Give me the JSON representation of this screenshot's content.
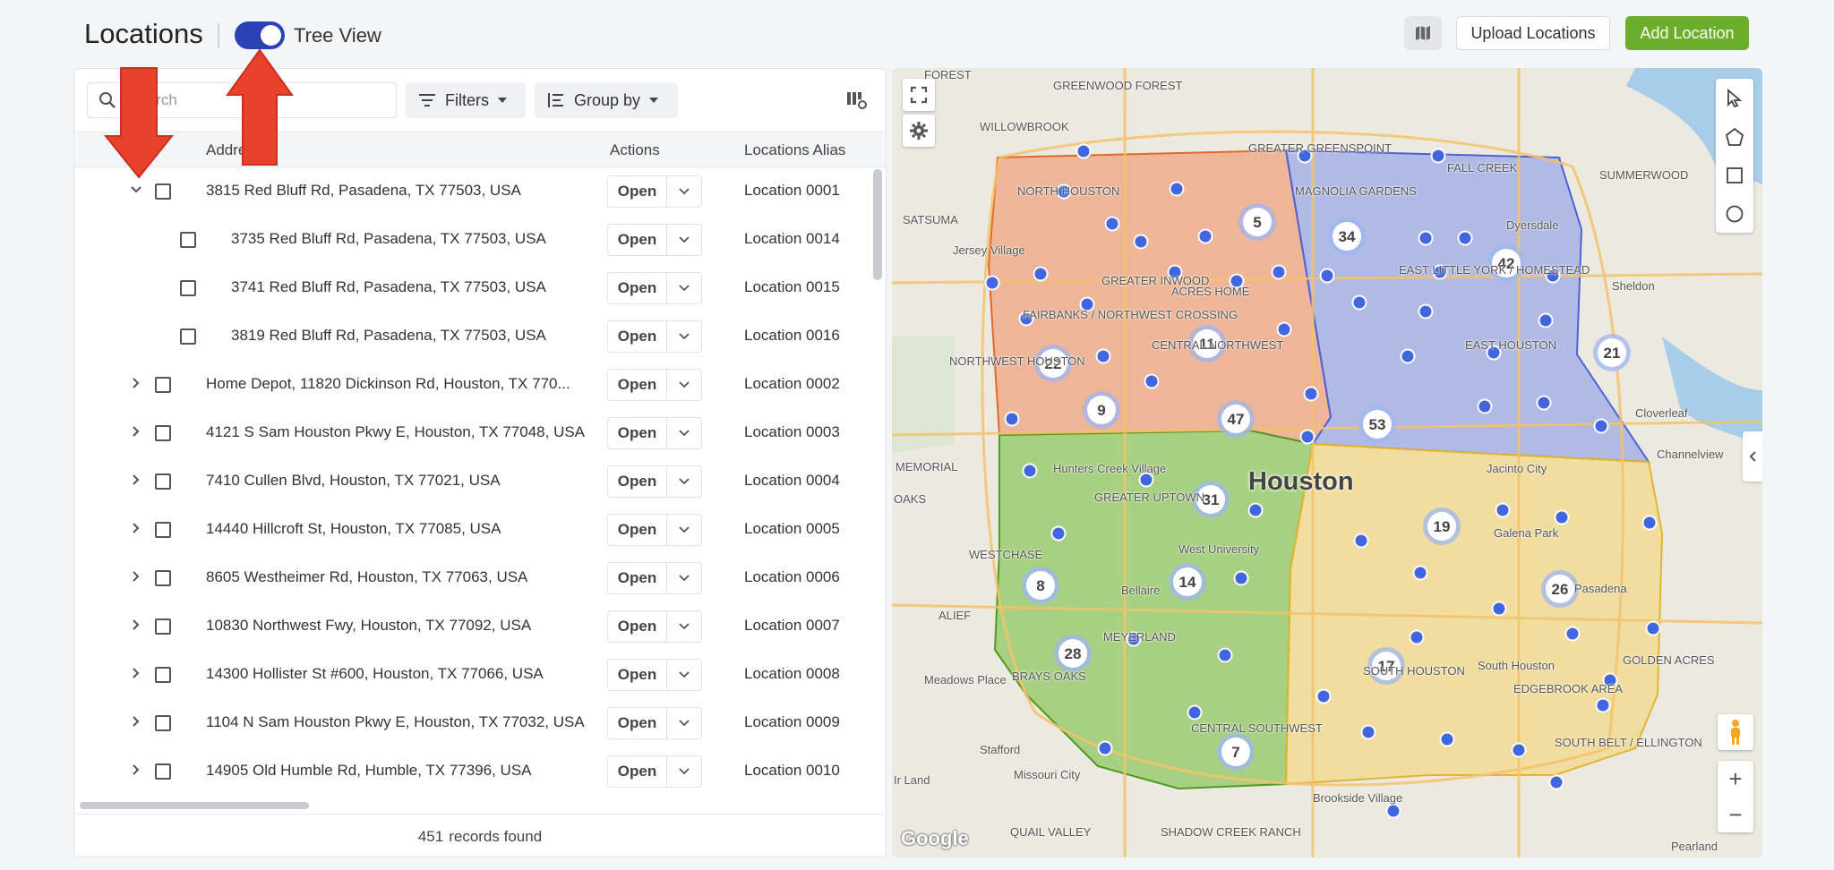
{
  "header": {
    "title": "Locations",
    "toggle_label": "Tree View",
    "toggle_on": true,
    "upload_label": "Upload Locations",
    "add_label": "Add Location"
  },
  "toolbar": {
    "search_placeholder": "Search",
    "filters_label": "Filters",
    "groupby_label": "Group by"
  },
  "table": {
    "columns": {
      "address": "Address",
      "actions": "Actions",
      "alias": "Locations Alias"
    },
    "open_label": "Open",
    "rows": [
      {
        "address": "3815 Red Bluff Rd, Pasadena, TX 77503, USA",
        "alias": "Location 0001",
        "level": 0,
        "expanded": true
      },
      {
        "address": "3735 Red Bluff Rd, Pasadena, TX 77503, USA",
        "alias": "Location 0014",
        "level": 1
      },
      {
        "address": "3741 Red Bluff Rd, Pasadena, TX 77503, USA",
        "alias": "Location 0015",
        "level": 1
      },
      {
        "address": "3819 Red Bluff Rd, Pasadena, TX 77503, USA",
        "alias": "Location 0016",
        "level": 1
      },
      {
        "address": "Home Depot, 11820 Dickinson Rd, Houston, TX 770...",
        "alias": "Location 0002",
        "level": 0
      },
      {
        "address": "4121 S Sam Houston Pkwy E, Houston, TX 77048, USA",
        "alias": "Location 0003",
        "level": 0
      },
      {
        "address": "7410 Cullen Blvd, Houston, TX 77021, USA",
        "alias": "Location 0004",
        "level": 0
      },
      {
        "address": "14440 Hillcroft St, Houston, TX 77085, USA",
        "alias": "Location 0005",
        "level": 0
      },
      {
        "address": "8605 Westheimer Rd, Houston, TX 77063, USA",
        "alias": "Location 0006",
        "level": 0
      },
      {
        "address": "10830 Northwest Fwy, Houston, TX 77092, USA",
        "alias": "Location 0007",
        "level": 0
      },
      {
        "address": "14300 Hollister St #600, Houston, TX 77066, USA",
        "alias": "Location 0008",
        "level": 0
      },
      {
        "address": "1104 N Sam Houston Pkwy E, Houston, TX 77032, USA",
        "alias": "Location 0009",
        "level": 0
      },
      {
        "address": "14905 Old Humble Rd, Humble, TX 77396, USA",
        "alias": "Location 0010",
        "level": 0
      }
    ]
  },
  "footer": {
    "count": "451",
    "suffix": "records found"
  },
  "map": {
    "city": "Houston",
    "attribution": "Google",
    "zones": [
      {
        "name": "northwest",
        "color": "#f08a5d"
      },
      {
        "name": "northeast",
        "color": "#7f93e8"
      },
      {
        "name": "southwest",
        "color": "#7cc043"
      },
      {
        "name": "southeast",
        "color": "#f5d36a"
      }
    ],
    "clusters": [
      "5",
      "34",
      "42",
      "11",
      "22",
      "9",
      "47",
      "53",
      "21",
      "31",
      "19",
      "8",
      "14",
      "26",
      "28",
      "17",
      "7"
    ],
    "places": [
      "FOREST",
      "GREENWOOD FOREST",
      "GREATER GREENSPOINT",
      "WILLOWBROOK",
      "NORTH HOUSTON",
      "MAGNOLIA GARDENS",
      "FALL CREEK",
      "SUMMERWOOD",
      "SATSUMA",
      "Jersey Village",
      "Dyersdale",
      "EAST LITTLE YORK / HOMESTEAD",
      "Sheldon",
      "GREATER INWOOD",
      "ACRES HOME",
      "FAIRBANKS / NORTHWEST CROSSING",
      "EAST HOUSTON",
      "NORTHWEST HOUSTON",
      "CENTRAL NORTHWEST",
      "Cloverleaf",
      "MEMORIAL",
      "Hunters Creek Village",
      "GREATER UPTOWN",
      "Jacinto City",
      "Channelview",
      "OAKS",
      "WESTCHASE",
      "West University",
      "Galena Park",
      "Bellaire",
      "Pasadena",
      "ALIEF",
      "MEYERLAND",
      "BRAYS OAKS",
      "SOUTH HOUSTON",
      "South Houston",
      "EDGEBROOK AREA",
      "GOLDEN ACRES",
      "Meadows Place",
      "CENTRAL SOUTHWEST",
      "Stafford",
      "Missouri City",
      "SOUTH BELT / ELLINGTON",
      "Brookside Village",
      "QUAIL VALLEY",
      "SHADOW CREEK RANCH",
      "Pearland",
      "Ir Land"
    ]
  }
}
